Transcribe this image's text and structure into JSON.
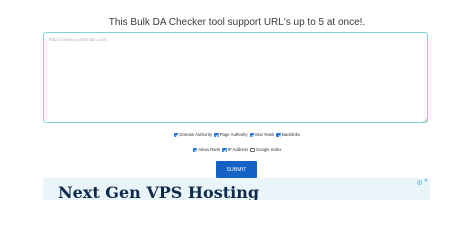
{
  "heading": "This Bulk DA Checker tool support URL's up to 5 at once!.",
  "url_input": {
    "value": "",
    "placeholder": "https://www.yourdomain.com"
  },
  "options_row1": [
    {
      "label": "Domain Authority",
      "checked": true
    },
    {
      "label": "Page Authority",
      "checked": true
    },
    {
      "label": "Moz Rank",
      "checked": true
    },
    {
      "label": "Backlinks",
      "checked": true
    }
  ],
  "options_row2": [
    {
      "label": "Alexa Rank",
      "checked": true
    },
    {
      "label": "IP Address",
      "checked": true
    },
    {
      "label": "Google Index",
      "checked": false
    }
  ],
  "submit_label": "SUBMIT",
  "ad": {
    "headline": "Next Gen VPS Hosting",
    "close_glyph": "✕",
    "choices_icon": "adchoices-icon"
  },
  "colors": {
    "checkbox_checked": "#1a73e8",
    "button": "#1463c4",
    "input_border": "#7fd4d8",
    "ad_background": "#e9f5f9",
    "ad_headline": "#0f2a4a"
  }
}
